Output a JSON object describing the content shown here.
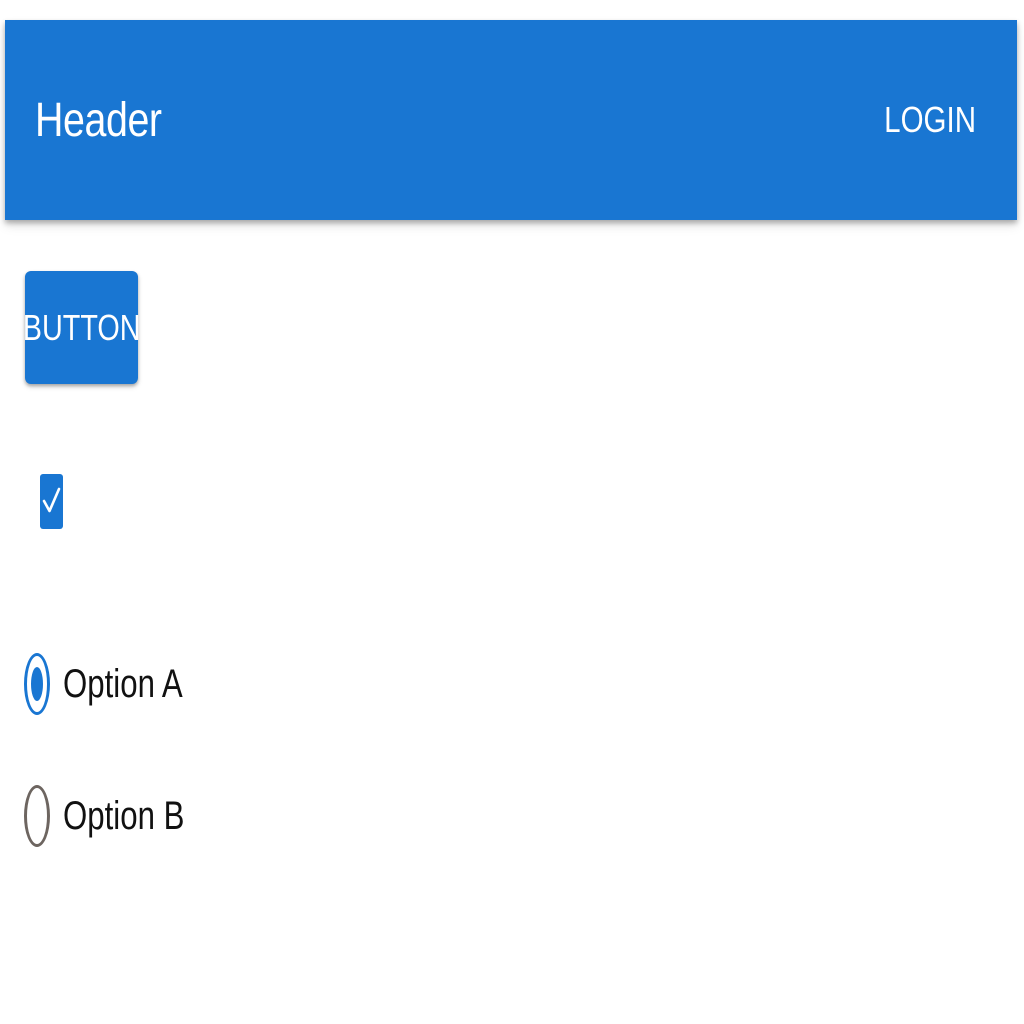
{
  "header": {
    "title": "Header",
    "login_label": "LOGIN"
  },
  "main": {
    "button_label": "BUTTON",
    "checkbox": {
      "checked": true
    },
    "radio_options": [
      {
        "label": "Option A",
        "selected": true
      },
      {
        "label": "Option B",
        "selected": false
      }
    ]
  },
  "icons": {
    "checkbox": "check-icon"
  },
  "colors": {
    "primary": "#1976d2",
    "radio_unselected": "#6d6560",
    "text": "#111111",
    "background": "#ffffff"
  }
}
